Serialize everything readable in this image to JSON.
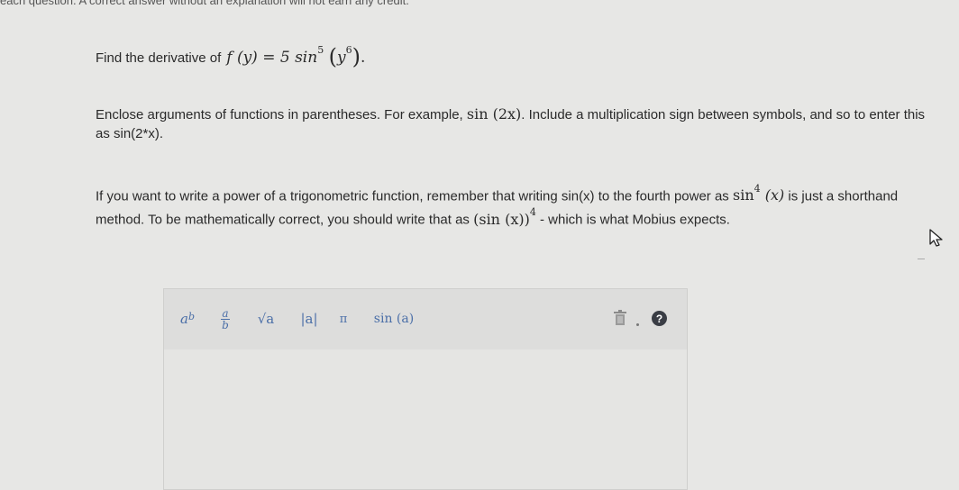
{
  "header": {
    "note": "each question. A correct answer without an explanation will not earn any credit."
  },
  "question": {
    "prefix": "Find the derivative of",
    "func_lhs": "f (y) = 5 sin",
    "sin_power": "5",
    "inner_base": "y",
    "inner_power": "6",
    "suffix": "."
  },
  "instructions": {
    "p1_part1": "Enclose arguments of functions in parentheses. For example,",
    "p1_math": "sin (2x)",
    "p1_part2": ". Include a multiplication sign between symbols, and so to enter this as sin(2*x).",
    "p2_part1": "If you want to write a power of a trigonometric function, remember that writing sin(x) to the fourth power as",
    "p2_math1": "sin",
    "p2_math1_power": "4",
    "p2_math1_arg": "(x)",
    "p2_part2": "is just a shorthand method. To be mathematically correct, you should write that as",
    "p2_math2": "(sin (x))",
    "p2_math2_power": "4",
    "p2_part3": "- which is what Mobius expects."
  },
  "toolbar": {
    "power_base": "a",
    "power_exp": "b",
    "frac_num": "a",
    "frac_den": "b",
    "sqrt_label": "√a",
    "abs_label": "|a|",
    "pi_label": "π",
    "sin_label": "sin (a)",
    "help_label": "?"
  },
  "icons": [
    "trash-icon",
    "help-icon",
    "mouse-cursor-icon"
  ]
}
